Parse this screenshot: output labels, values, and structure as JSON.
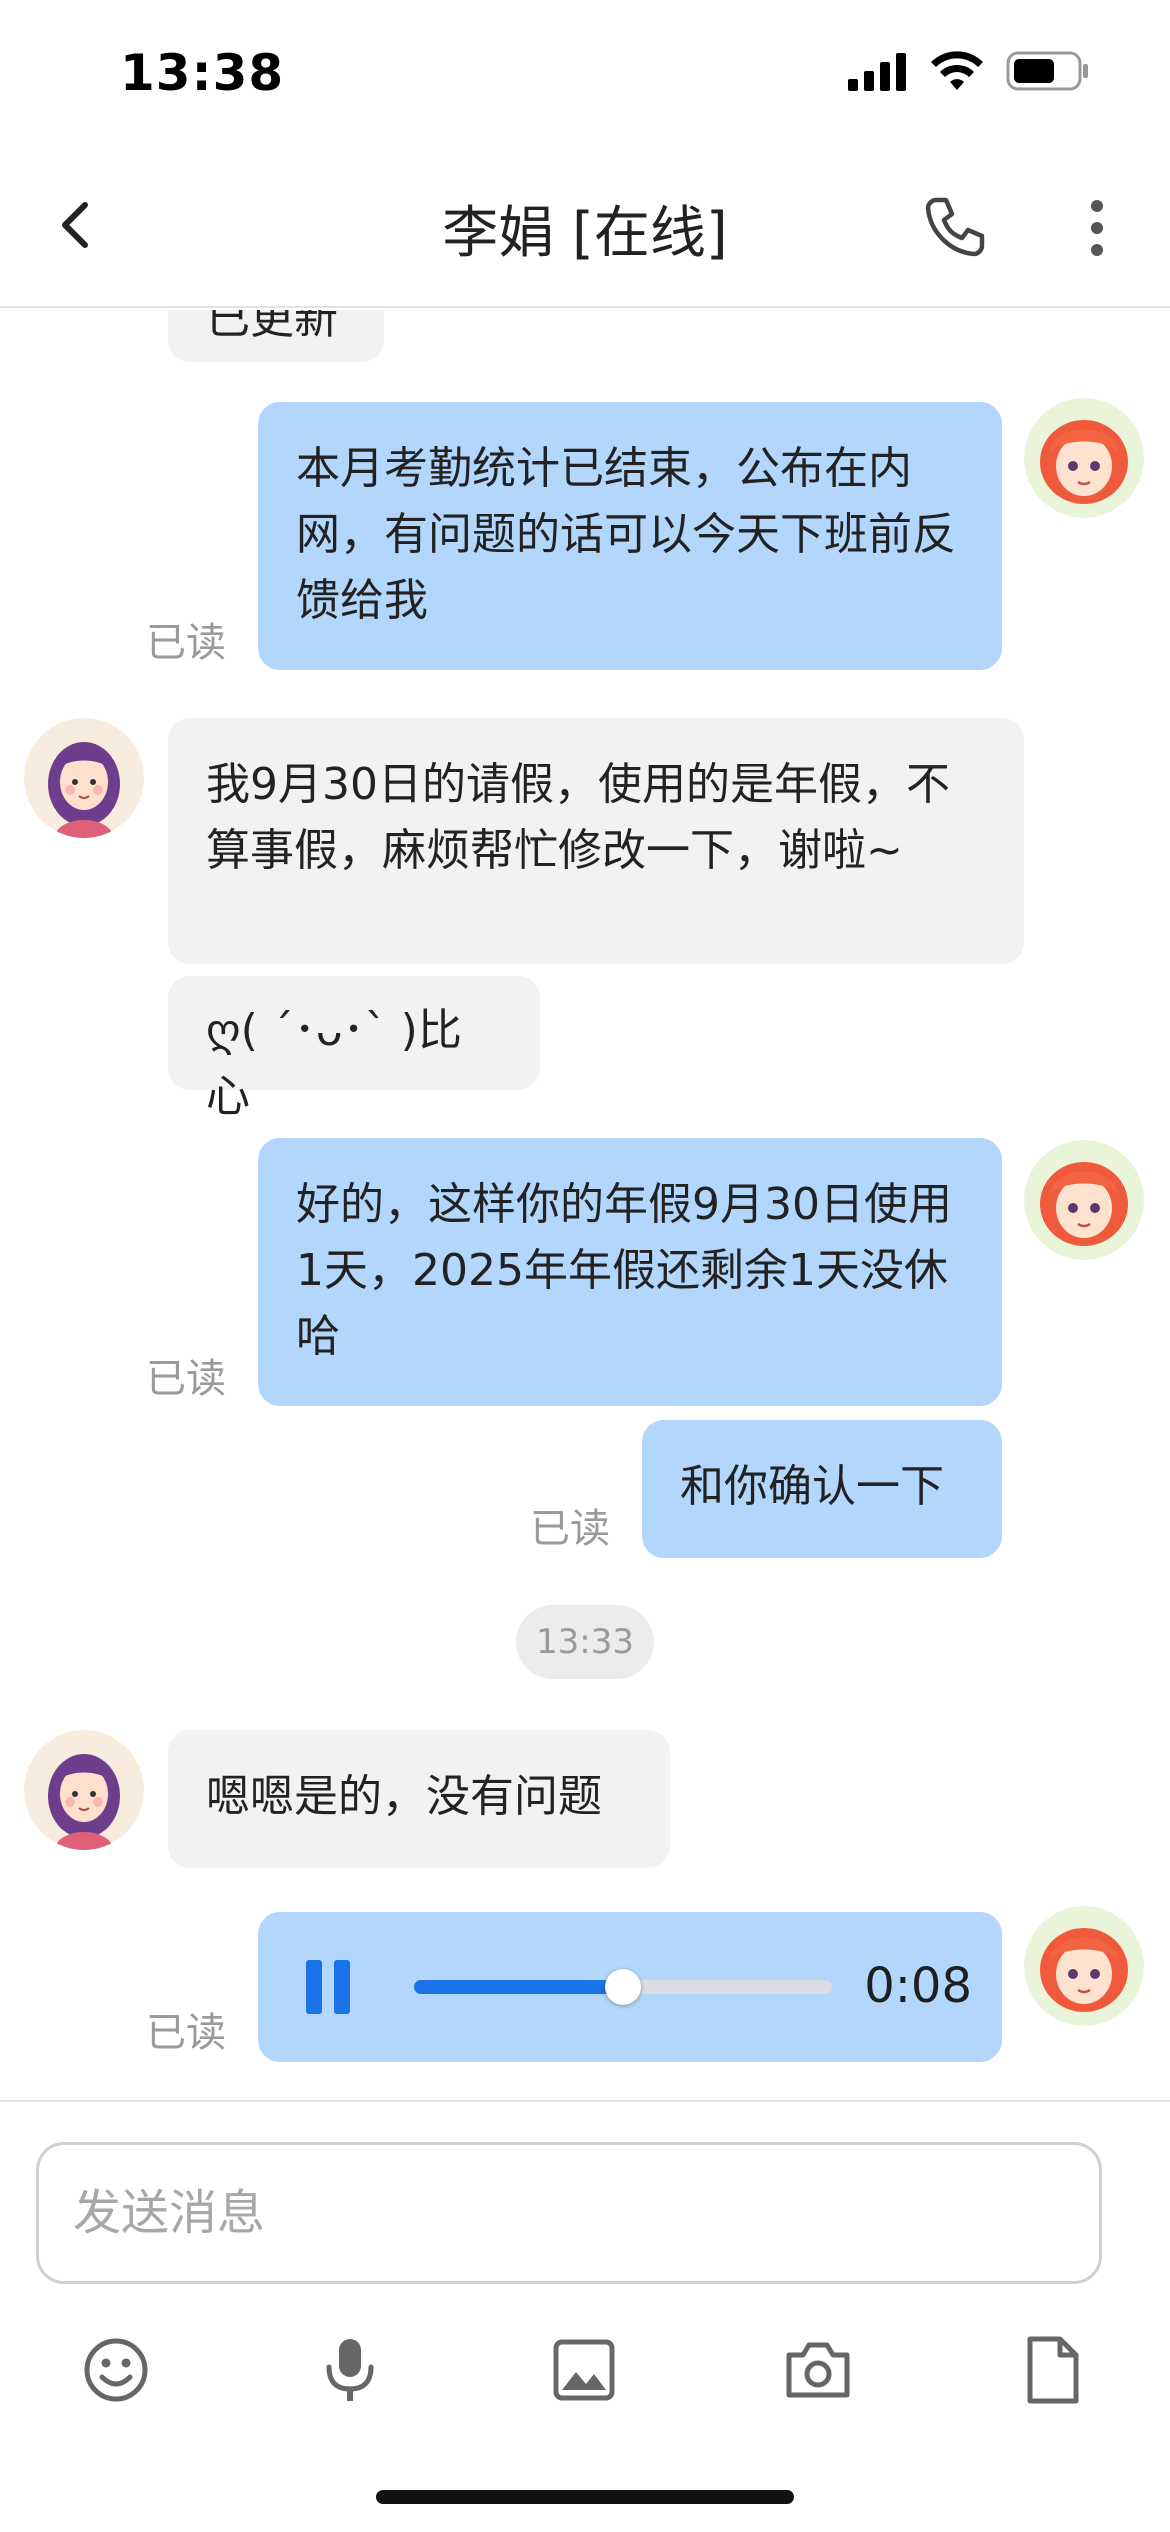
{
  "status": {
    "time": "13:38"
  },
  "header": {
    "title": "李娟 [在线]"
  },
  "messages": {
    "partial_text": "已更新",
    "m1": "本月考勤统计已结束，公布在内网，有问题的话可以今天下班前反馈给我",
    "m2": "我9月30日的请假，使用的是年假，不算事假，麻烦帮忙修改一下，谢啦~",
    "m3": "ღ( ´･ᴗ･` )比心",
    "m4": "好的，这样你的年假9月30日使用1天，2025年年假还剩余1天没休哈",
    "m5": "和你确认一下",
    "m6": "嗯嗯是的，没有问题",
    "read_label": "已读"
  },
  "timestamp": "13:33",
  "voice": {
    "duration": "0:08",
    "progress": 0.5,
    "state": "playing"
  },
  "composer": {
    "placeholder": "发送消息"
  },
  "icons": [
    "back-icon",
    "phone-icon",
    "more-icon",
    "emoji-icon",
    "mic-icon",
    "image-icon",
    "camera-icon",
    "file-icon",
    "pause-icon"
  ],
  "colors": {
    "outgoing": "#b3d7fc",
    "incoming": "#f2f2f2",
    "accent": "#1a73e8"
  }
}
